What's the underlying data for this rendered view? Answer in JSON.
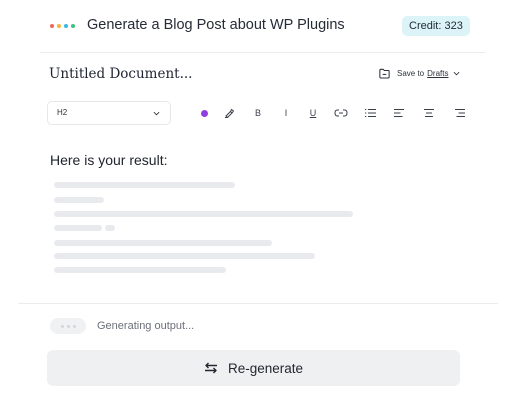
{
  "header": {
    "dot_colors": [
      "#f2665b",
      "#f4b63c",
      "#3cb7e8",
      "#3fc386"
    ],
    "title": "Generate a Blog Post about WP Plugins",
    "credit_label": "Credit: 323",
    "credit_bg": "#dcf3f8"
  },
  "document": {
    "title": "Untitled Document...",
    "save_prefix": "Save to",
    "save_target": "Drafts"
  },
  "toolbar": {
    "heading_select_value": "H2",
    "color_dot": "#8f3fe0",
    "bold": "B",
    "italic": "I",
    "underline": "U",
    "icons": [
      "color-dot-icon",
      "highlighter-icon",
      "bold-icon",
      "italic-icon",
      "underline-icon",
      "link-icon",
      "list-icon",
      "align-left-icon",
      "align-center-icon",
      "align-right-icon"
    ]
  },
  "result": {
    "label": "Here is your result:"
  },
  "status": {
    "generating_text": "Generating output..."
  },
  "actions": {
    "regenerate_label": "Re-generate",
    "regenerate_icon": "swap-arrows-icon"
  }
}
